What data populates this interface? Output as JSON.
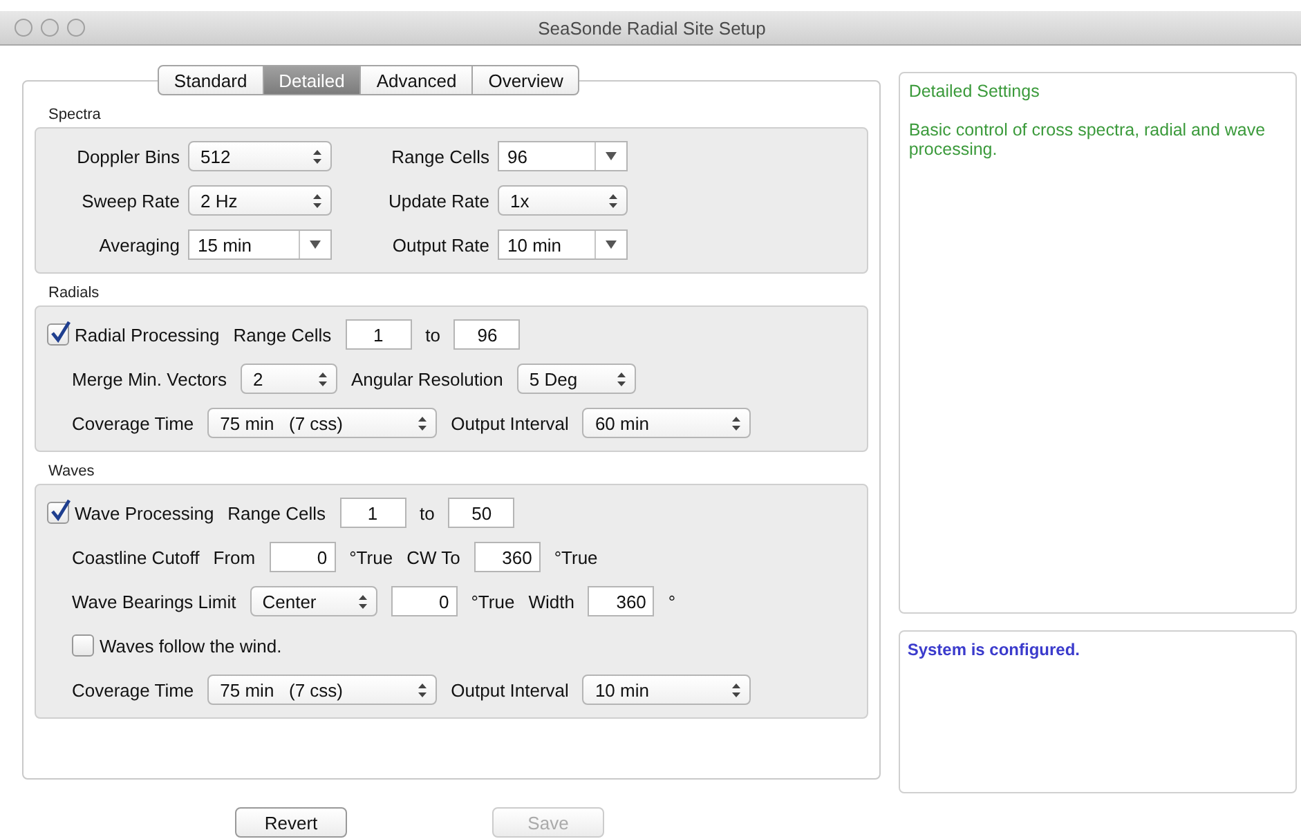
{
  "window": {
    "title": "SeaSonde Radial Site Setup"
  },
  "tabs": [
    {
      "label": "Standard",
      "selected": false
    },
    {
      "label": "Detailed",
      "selected": true
    },
    {
      "label": "Advanced",
      "selected": false
    },
    {
      "label": "Overview",
      "selected": false
    }
  ],
  "sections": [
    {
      "title": "Spectra",
      "rows": [
        {
          "controls": [
            {
              "kind": "label",
              "text": "Doppler Bins"
            },
            {
              "kind": "stepper",
              "value": "512"
            },
            {
              "kind": "label",
              "text": "Range Cells"
            },
            {
              "kind": "dropdown",
              "value": "96"
            }
          ]
        },
        {
          "controls": [
            {
              "kind": "label",
              "text": "Sweep Rate"
            },
            {
              "kind": "stepper",
              "value": "2 Hz"
            },
            {
              "kind": "label",
              "text": "Update Rate"
            },
            {
              "kind": "stepper",
              "value": "1x"
            }
          ]
        },
        {
          "controls": [
            {
              "kind": "label",
              "text": "Averaging"
            },
            {
              "kind": "dropdown",
              "value": "15 min"
            },
            {
              "kind": "label",
              "text": "Output Rate"
            },
            {
              "kind": "dropdown",
              "value": "10 min"
            }
          ]
        }
      ]
    },
    {
      "title": "Radials",
      "rows": [
        {
          "controls": [
            {
              "kind": "checkbox",
              "text": "Radial Processing",
              "checked": true
            },
            {
              "kind": "label",
              "text": "Range Cells"
            },
            {
              "kind": "field",
              "value": "1"
            },
            {
              "kind": "label",
              "text": "to"
            },
            {
              "kind": "field",
              "value": "96"
            }
          ]
        },
        {
          "controls": [
            {
              "kind": "label",
              "text": "Merge Min. Vectors"
            },
            {
              "kind": "stepper",
              "value": "2"
            },
            {
              "kind": "label",
              "text": "Angular Resolution"
            },
            {
              "kind": "stepper",
              "value": "5 Deg"
            }
          ]
        },
        {
          "controls": [
            {
              "kind": "label",
              "text": "Coverage Time"
            },
            {
              "kind": "stepper",
              "value": "75 min   (7 css)"
            },
            {
              "kind": "label",
              "text": "Output Interval"
            },
            {
              "kind": "stepper",
              "value": "60 min"
            }
          ]
        }
      ]
    },
    {
      "title": "Waves",
      "rows": [
        {
          "controls": [
            {
              "kind": "checkbox",
              "text": "Wave Processing",
              "checked": true
            },
            {
              "kind": "label",
              "text": "Range Cells"
            },
            {
              "kind": "field",
              "value": "1"
            },
            {
              "kind": "label",
              "text": "to"
            },
            {
              "kind": "field",
              "value": "50"
            }
          ]
        },
        {
          "controls": [
            {
              "kind": "label",
              "text": "Coastline Cutoff"
            },
            {
              "kind": "label",
              "text": "From"
            },
            {
              "kind": "number",
              "value": "0"
            },
            {
              "kind": "unit",
              "text": "°True"
            },
            {
              "kind": "label",
              "text": "CW To"
            },
            {
              "kind": "number",
              "value": "360"
            },
            {
              "kind": "unit",
              "text": "°True"
            }
          ]
        },
        {
          "controls": [
            {
              "kind": "label",
              "text": "Wave Bearings Limit"
            },
            {
              "kind": "stepper",
              "value": "Center"
            },
            {
              "kind": "number",
              "value": "0"
            },
            {
              "kind": "unit",
              "text": "°True"
            },
            {
              "kind": "label",
              "text": "Width"
            },
            {
              "kind": "number",
              "value": "360"
            },
            {
              "kind": "unit",
              "text": "°"
            }
          ]
        },
        {
          "controls": [
            {
              "kind": "checkbox",
              "text": "Waves follow the wind.",
              "checked": false
            }
          ]
        },
        {
          "controls": [
            {
              "kind": "label",
              "text": "Coverage Time"
            },
            {
              "kind": "stepper",
              "value": "75 min   (7 css)"
            },
            {
              "kind": "label",
              "text": "Output Interval"
            },
            {
              "kind": "stepper",
              "value": "10 min"
            }
          ]
        }
      ]
    }
  ],
  "buttons": [
    {
      "label": "Revert",
      "disabled": false
    },
    {
      "label": "Save",
      "disabled": true
    }
  ],
  "info": {
    "title": "Detailed Settings",
    "text": "Basic control of cross spectra, radial and wave processing."
  },
  "status": {
    "text": "System is configured."
  }
}
